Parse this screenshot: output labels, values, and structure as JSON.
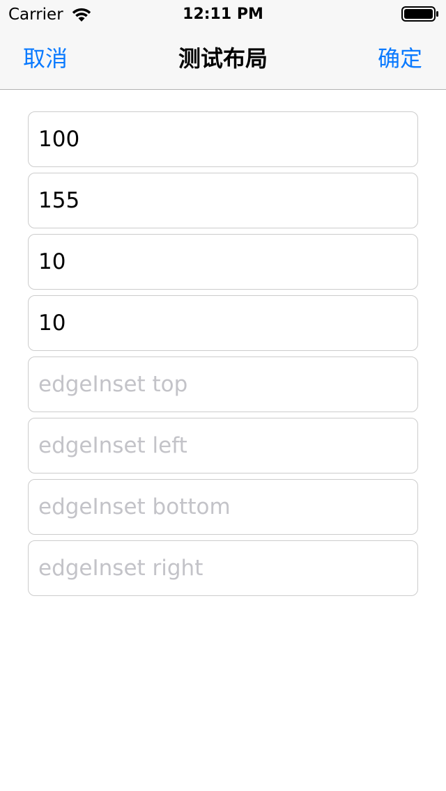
{
  "status_bar": {
    "carrier": "Carrier",
    "time": "12:11 PM",
    "icons": [
      "wifi-icon",
      "battery-icon"
    ]
  },
  "nav": {
    "left_label": "取消",
    "title": "测试布局",
    "right_label": "确定",
    "accent_color": "#0a7aff"
  },
  "fields": [
    {
      "value": "100",
      "placeholder": ""
    },
    {
      "value": "155",
      "placeholder": ""
    },
    {
      "value": "10",
      "placeholder": ""
    },
    {
      "value": "10",
      "placeholder": ""
    },
    {
      "value": "",
      "placeholder": "edgeInset top"
    },
    {
      "value": "",
      "placeholder": "edgeInset left"
    },
    {
      "value": "",
      "placeholder": "edgeInset bottom"
    },
    {
      "value": "",
      "placeholder": "edgeInset right"
    }
  ]
}
